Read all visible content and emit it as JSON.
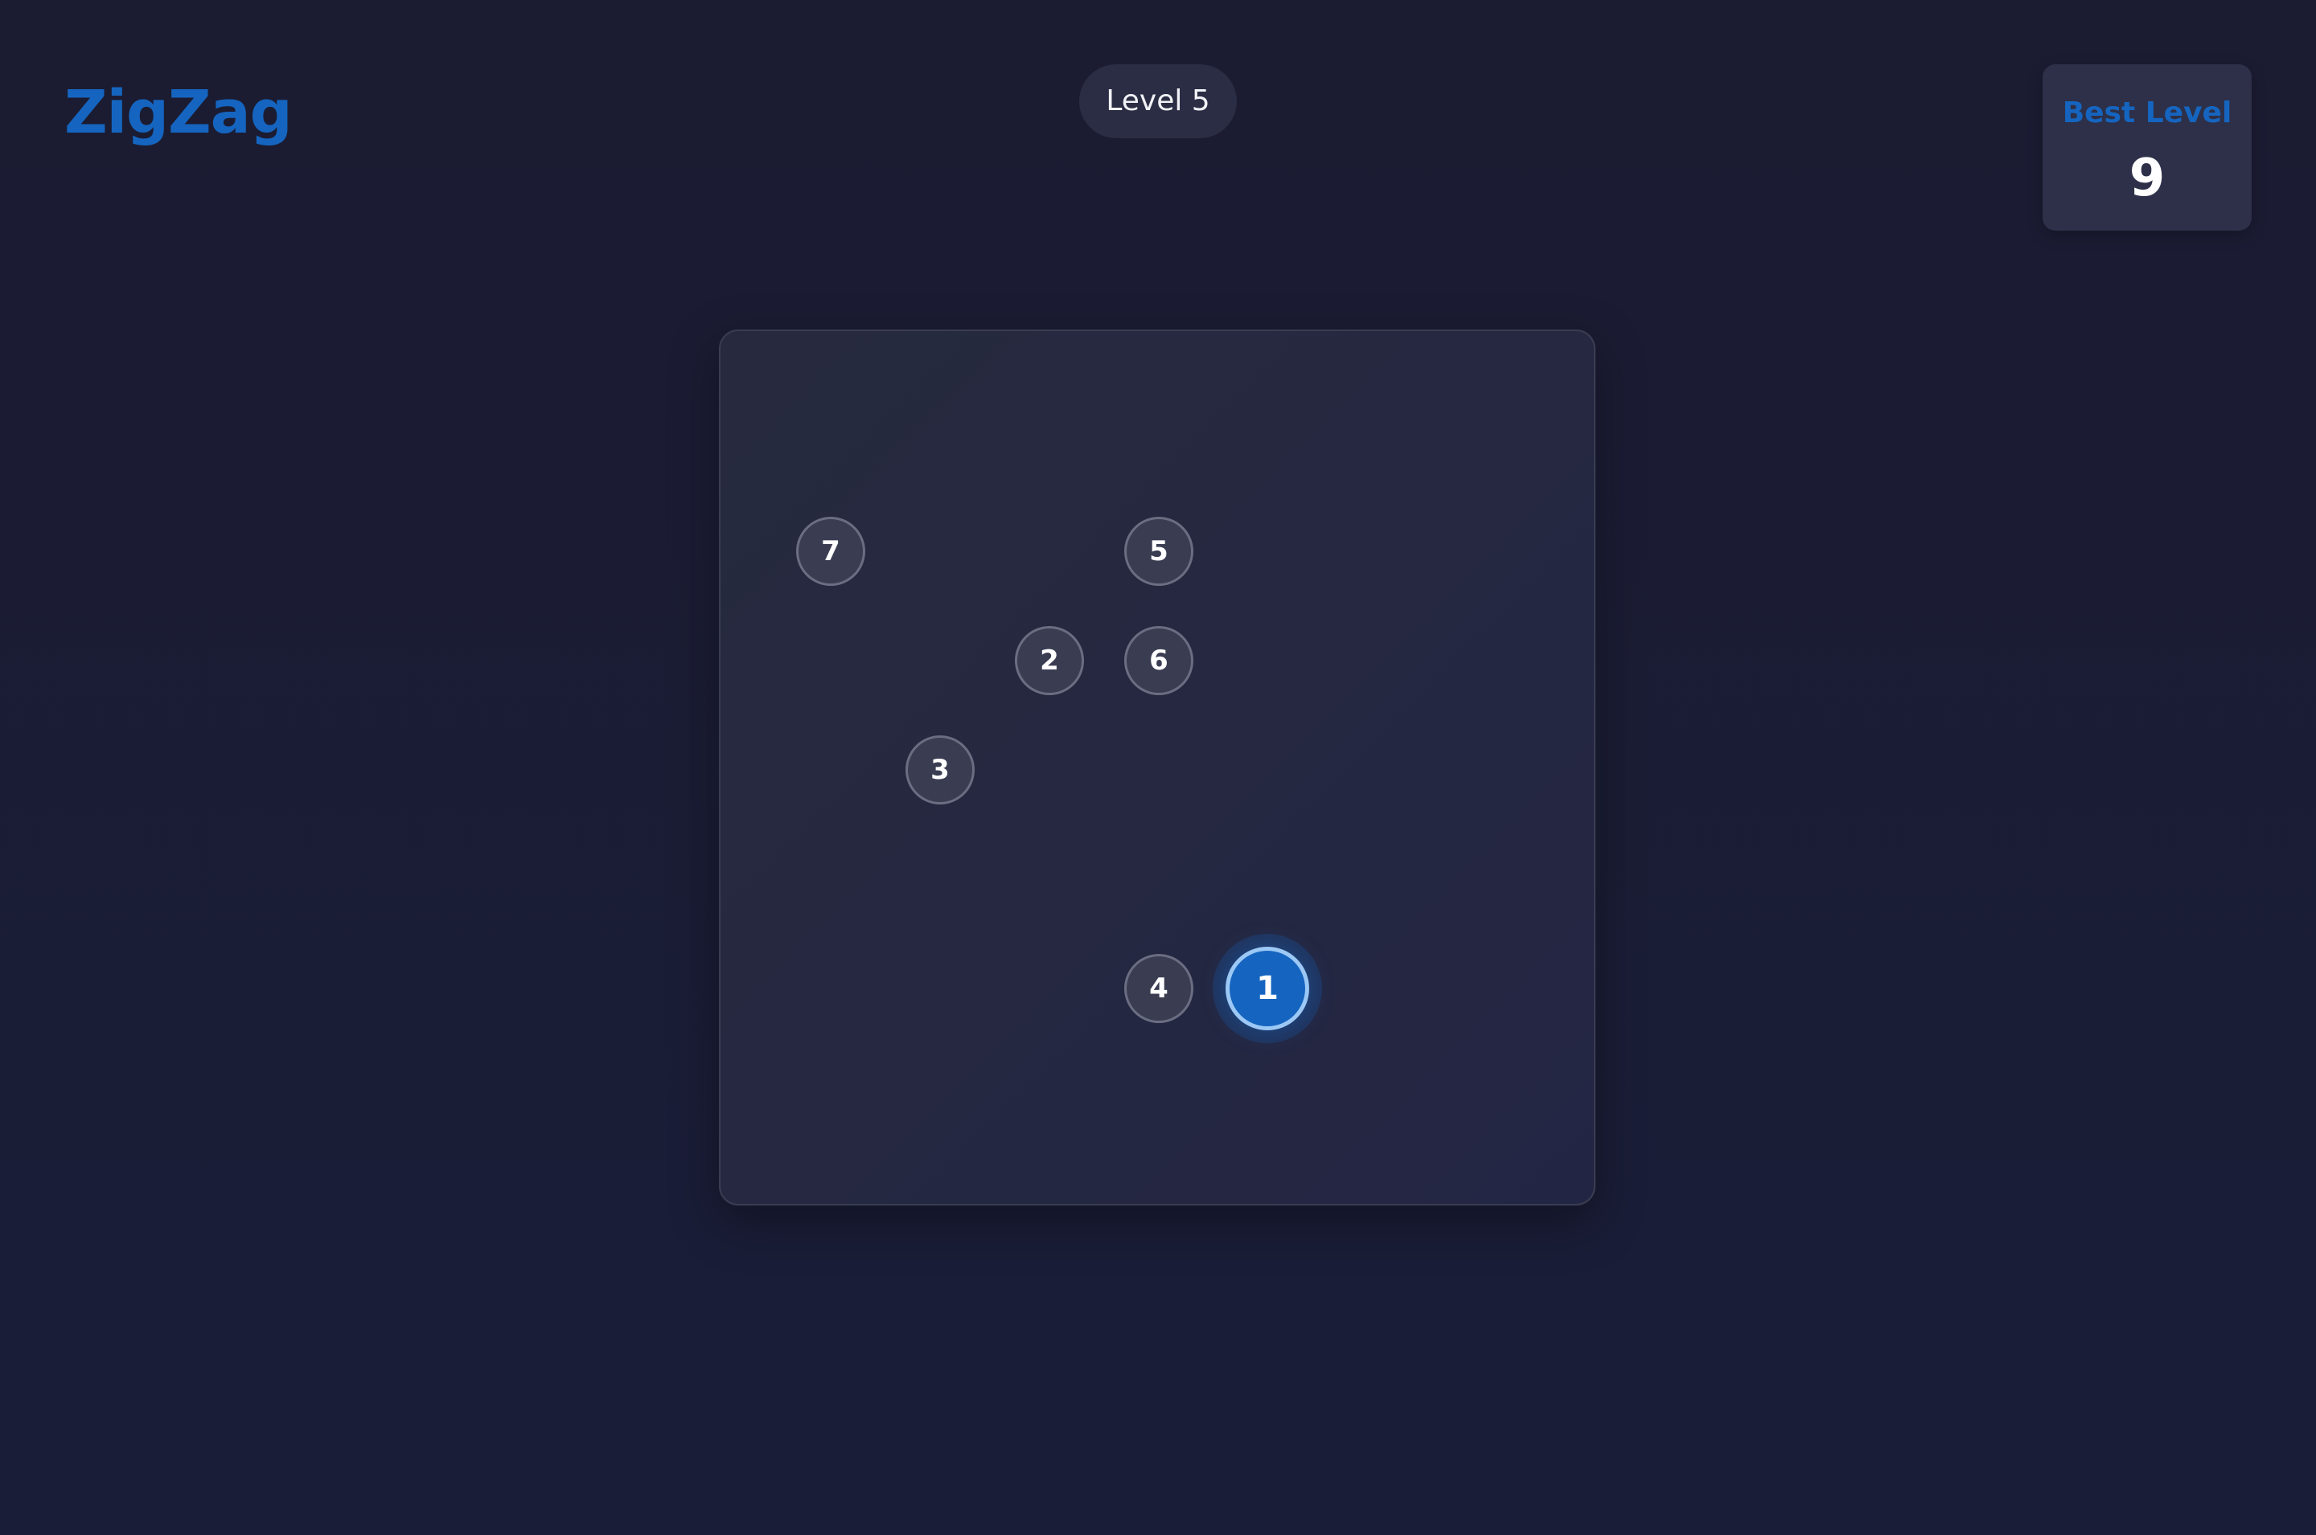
{
  "app": {
    "title": "ZigZag"
  },
  "header": {
    "level_label": "Level 5",
    "best": {
      "label": "Best Level",
      "value": "9"
    }
  },
  "board": {
    "nodes": [
      {
        "label": "1",
        "state": "active"
      },
      {
        "label": "2",
        "state": "idle"
      },
      {
        "label": "3",
        "state": "idle"
      },
      {
        "label": "4",
        "state": "idle"
      },
      {
        "label": "5",
        "state": "idle"
      },
      {
        "label": "6",
        "state": "idle"
      },
      {
        "label": "7",
        "state": "idle"
      }
    ]
  },
  "colors": {
    "accent": "#1565c0",
    "background": "#1b1c32",
    "node_idle": "#3a3d52",
    "active_ring": "#9cc8f5"
  }
}
